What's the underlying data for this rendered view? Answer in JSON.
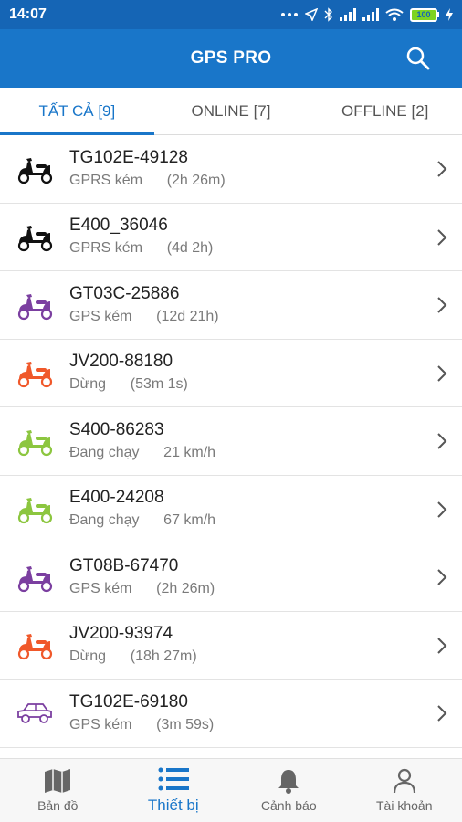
{
  "status_bar": {
    "time": "14:07",
    "battery": "100"
  },
  "app_bar": {
    "title": "GPS PRO",
    "search_icon": "search-icon"
  },
  "tabs": [
    {
      "label": "TẤT CẢ [9]",
      "active": true
    },
    {
      "label": "ONLINE [7]",
      "active": false
    },
    {
      "label": "OFFLINE [2]",
      "active": false
    }
  ],
  "devices": [
    {
      "name": "TG102E-49128",
      "status": "GPRS kém      (2h 26m)",
      "icon": "scooter-icon",
      "color": "#111111"
    },
    {
      "name": "E400_36046",
      "status": "GPRS kém      (4d 2h)",
      "icon": "scooter-icon",
      "color": "#111111"
    },
    {
      "name": "GT03C-25886",
      "status": "GPS kém      (12d 21h)",
      "icon": "scooter-icon",
      "color": "#7b3fa0"
    },
    {
      "name": "JV200-88180",
      "status": "Dừng      (53m 1s)",
      "icon": "scooter-icon",
      "color": "#f0582a"
    },
    {
      "name": "S400-86283",
      "status": "Đang chạy      21 km/h",
      "icon": "scooter-icon",
      "color": "#8cc63f"
    },
    {
      "name": "E400-24208",
      "status": "Đang chạy      67 km/h",
      "icon": "scooter-icon",
      "color": "#8cc63f"
    },
    {
      "name": "GT08B-67470",
      "status": "GPS kém      (2h 26m)",
      "icon": "scooter-icon",
      "color": "#7b3fa0"
    },
    {
      "name": "JV200-93974",
      "status": "Dừng      (18h 27m)",
      "icon": "scooter-icon",
      "color": "#f0582a"
    },
    {
      "name": "TG102E-69180",
      "status": "GPS kém      (3m 59s)",
      "icon": "car-icon",
      "color": "#7b3fa0"
    }
  ],
  "bottom_nav": [
    {
      "label": "Bản đồ",
      "icon": "map-icon",
      "active": false
    },
    {
      "label": "Thiết bị",
      "icon": "list-icon",
      "active": true
    },
    {
      "label": "Cảnh báo",
      "icon": "bell-icon",
      "active": false
    },
    {
      "label": "Tài khoản",
      "icon": "user-icon",
      "active": false
    }
  ],
  "colors": {
    "primary": "#1976c9",
    "statusbar": "#1565b5"
  }
}
